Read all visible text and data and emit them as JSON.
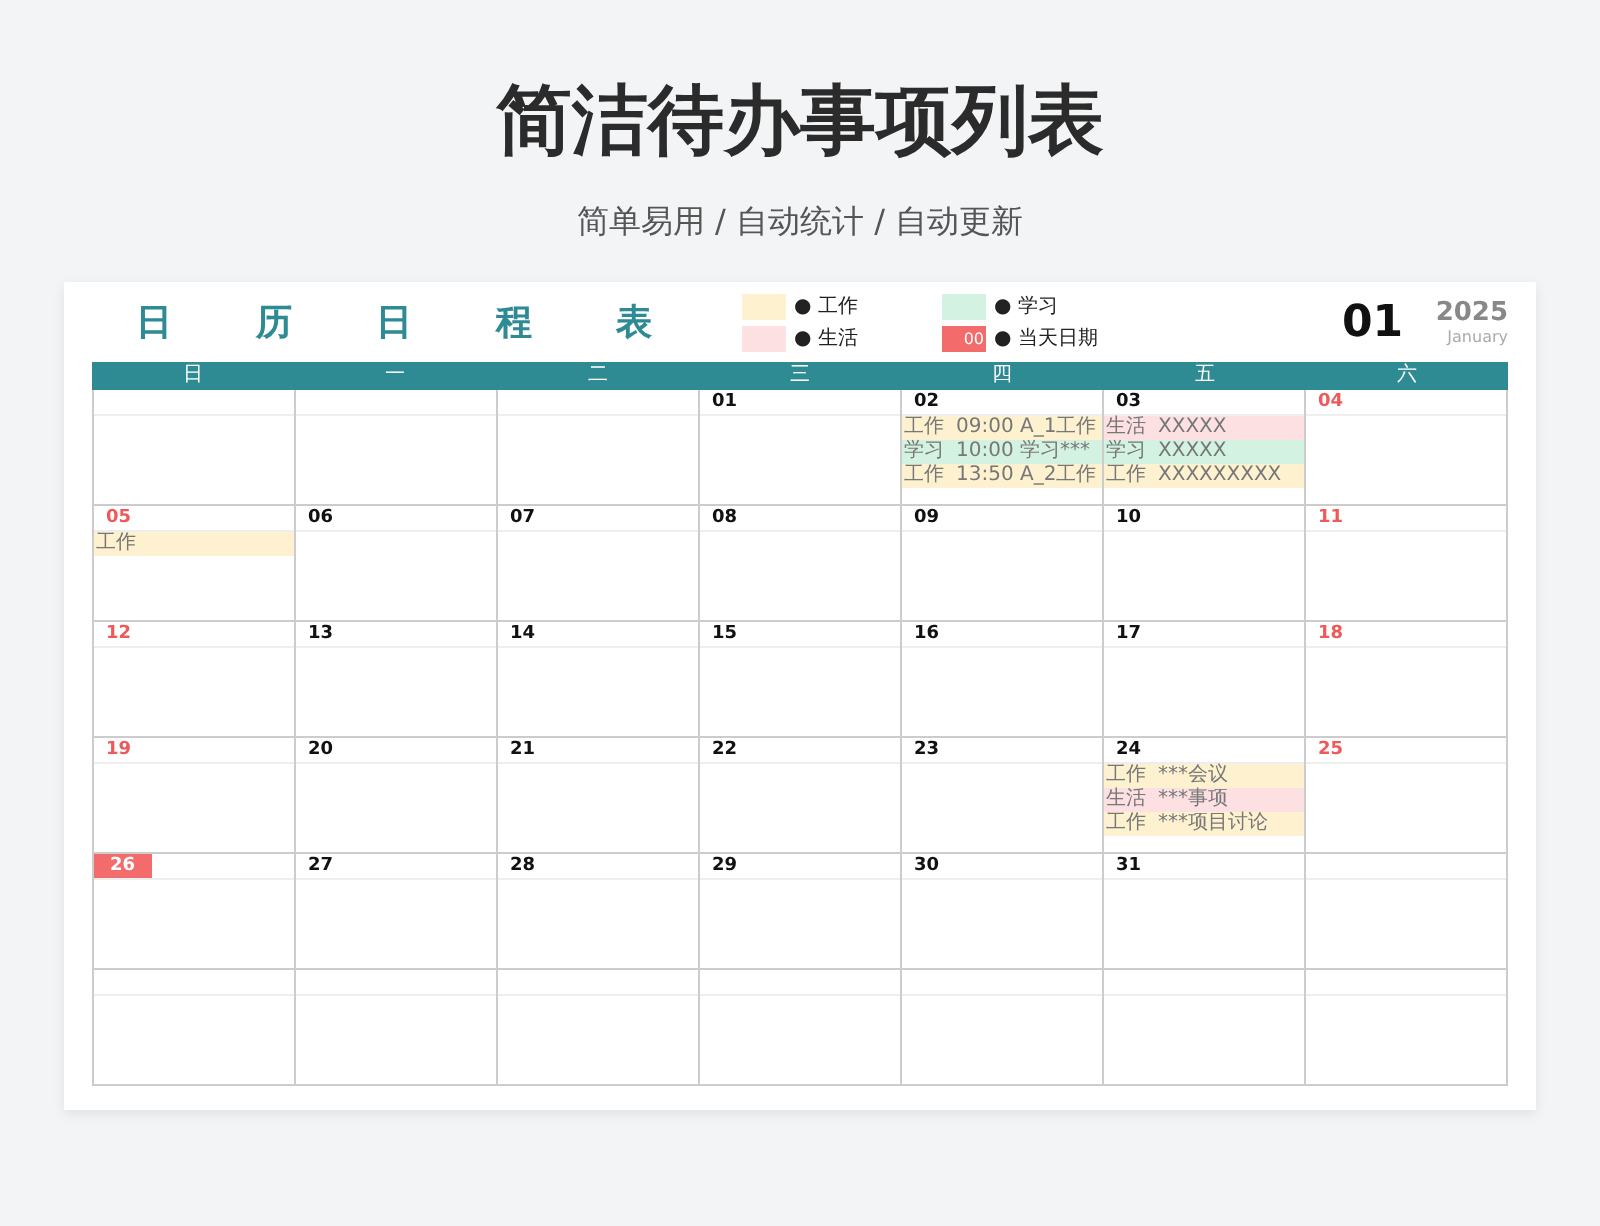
{
  "page": {
    "title": "简洁待办事项列表",
    "subtitle": "简单易用 / 自动统计 / 自动更新"
  },
  "calendar": {
    "title": "日历日程表",
    "month": "01",
    "year": "2025",
    "month_name": "January",
    "legend": [
      {
        "kind": "work",
        "label": "● 工作"
      },
      {
        "kind": "study",
        "label": "● 学习"
      },
      {
        "kind": "life",
        "label": "● 生活"
      },
      {
        "kind": "today",
        "label": "● 当天日期",
        "swatch_text": "00"
      }
    ],
    "weekdays": [
      "日",
      "一",
      "二",
      "三",
      "四",
      "五",
      "六"
    ],
    "weeks": [
      {
        "days": [
          {
            "kind": "blank"
          },
          {
            "kind": "blank"
          },
          {
            "kind": "blank"
          },
          {
            "kind": "day",
            "date": "01",
            "weekend": false,
            "today": false
          },
          {
            "kind": "day",
            "date": "02",
            "weekend": false,
            "today": false,
            "events": [
              {
                "kind": "work",
                "category": "工作",
                "text": "09:00 A_1工作"
              },
              {
                "kind": "study",
                "category": "学习",
                "text": "10:00 学习***"
              },
              {
                "kind": "work",
                "category": "工作",
                "text": "13:50 A_2工作"
              }
            ]
          },
          {
            "kind": "day",
            "date": "03",
            "weekend": false,
            "today": false,
            "events": [
              {
                "kind": "life",
                "category": "生活",
                "text": "XXXXX"
              },
              {
                "kind": "study",
                "category": "学习",
                "text": "XXXXX"
              },
              {
                "kind": "work",
                "category": "工作",
                "text": "XXXXXXXXX"
              }
            ]
          },
          {
            "kind": "day",
            "date": "04",
            "weekend": true,
            "today": false
          }
        ]
      },
      {
        "days": [
          {
            "kind": "day",
            "date": "05",
            "weekend": true,
            "today": false,
            "events": [
              {
                "kind": "work",
                "category": "工作"
              }
            ]
          },
          {
            "kind": "day",
            "date": "06",
            "weekend": false,
            "today": false
          },
          {
            "kind": "day",
            "date": "07",
            "weekend": false,
            "today": false
          },
          {
            "kind": "day",
            "date": "08",
            "weekend": false,
            "today": false
          },
          {
            "kind": "day",
            "date": "09",
            "weekend": false,
            "today": false
          },
          {
            "kind": "day",
            "date": "10",
            "weekend": false,
            "today": false
          },
          {
            "kind": "day",
            "date": "11",
            "weekend": true,
            "today": false
          }
        ]
      },
      {
        "days": [
          {
            "kind": "day",
            "date": "12",
            "weekend": true,
            "today": false
          },
          {
            "kind": "day",
            "date": "13",
            "weekend": false,
            "today": false
          },
          {
            "kind": "day",
            "date": "14",
            "weekend": false,
            "today": false
          },
          {
            "kind": "day",
            "date": "15",
            "weekend": false,
            "today": false
          },
          {
            "kind": "day",
            "date": "16",
            "weekend": false,
            "today": false
          },
          {
            "kind": "day",
            "date": "17",
            "weekend": false,
            "today": false
          },
          {
            "kind": "day",
            "date": "18",
            "weekend": true,
            "today": false
          }
        ]
      },
      {
        "days": [
          {
            "kind": "day",
            "date": "19",
            "weekend": true,
            "today": false
          },
          {
            "kind": "day",
            "date": "20",
            "weekend": false,
            "today": false
          },
          {
            "kind": "day",
            "date": "21",
            "weekend": false,
            "today": false
          },
          {
            "kind": "day",
            "date": "22",
            "weekend": false,
            "today": false
          },
          {
            "kind": "day",
            "date": "23",
            "weekend": false,
            "today": false
          },
          {
            "kind": "day",
            "date": "24",
            "weekend": false,
            "today": false,
            "events": [
              {
                "kind": "work",
                "category": "工作",
                "text": "***会议"
              },
              {
                "kind": "life",
                "category": "生活",
                "text": "***事项"
              },
              {
                "kind": "work",
                "category": "工作",
                "text": "***项目讨论"
              }
            ]
          },
          {
            "kind": "day",
            "date": "25",
            "weekend": true,
            "today": false
          }
        ]
      },
      {
        "days": [
          {
            "kind": "day",
            "date": "26",
            "weekend": true,
            "today": true
          },
          {
            "kind": "day",
            "date": "27",
            "weekend": false,
            "today": false
          },
          {
            "kind": "day",
            "date": "28",
            "weekend": false,
            "today": false
          },
          {
            "kind": "day",
            "date": "29",
            "weekend": false,
            "today": false
          },
          {
            "kind": "day",
            "date": "30",
            "weekend": false,
            "today": false
          },
          {
            "kind": "day",
            "date": "31",
            "weekend": false,
            "today": false
          },
          {
            "kind": "blank"
          }
        ]
      },
      {
        "days": [
          {
            "kind": "blank"
          },
          {
            "kind": "blank"
          },
          {
            "kind": "blank"
          },
          {
            "kind": "blank"
          },
          {
            "kind": "blank"
          },
          {
            "kind": "blank"
          },
          {
            "kind": "blank"
          }
        ]
      }
    ]
  }
}
